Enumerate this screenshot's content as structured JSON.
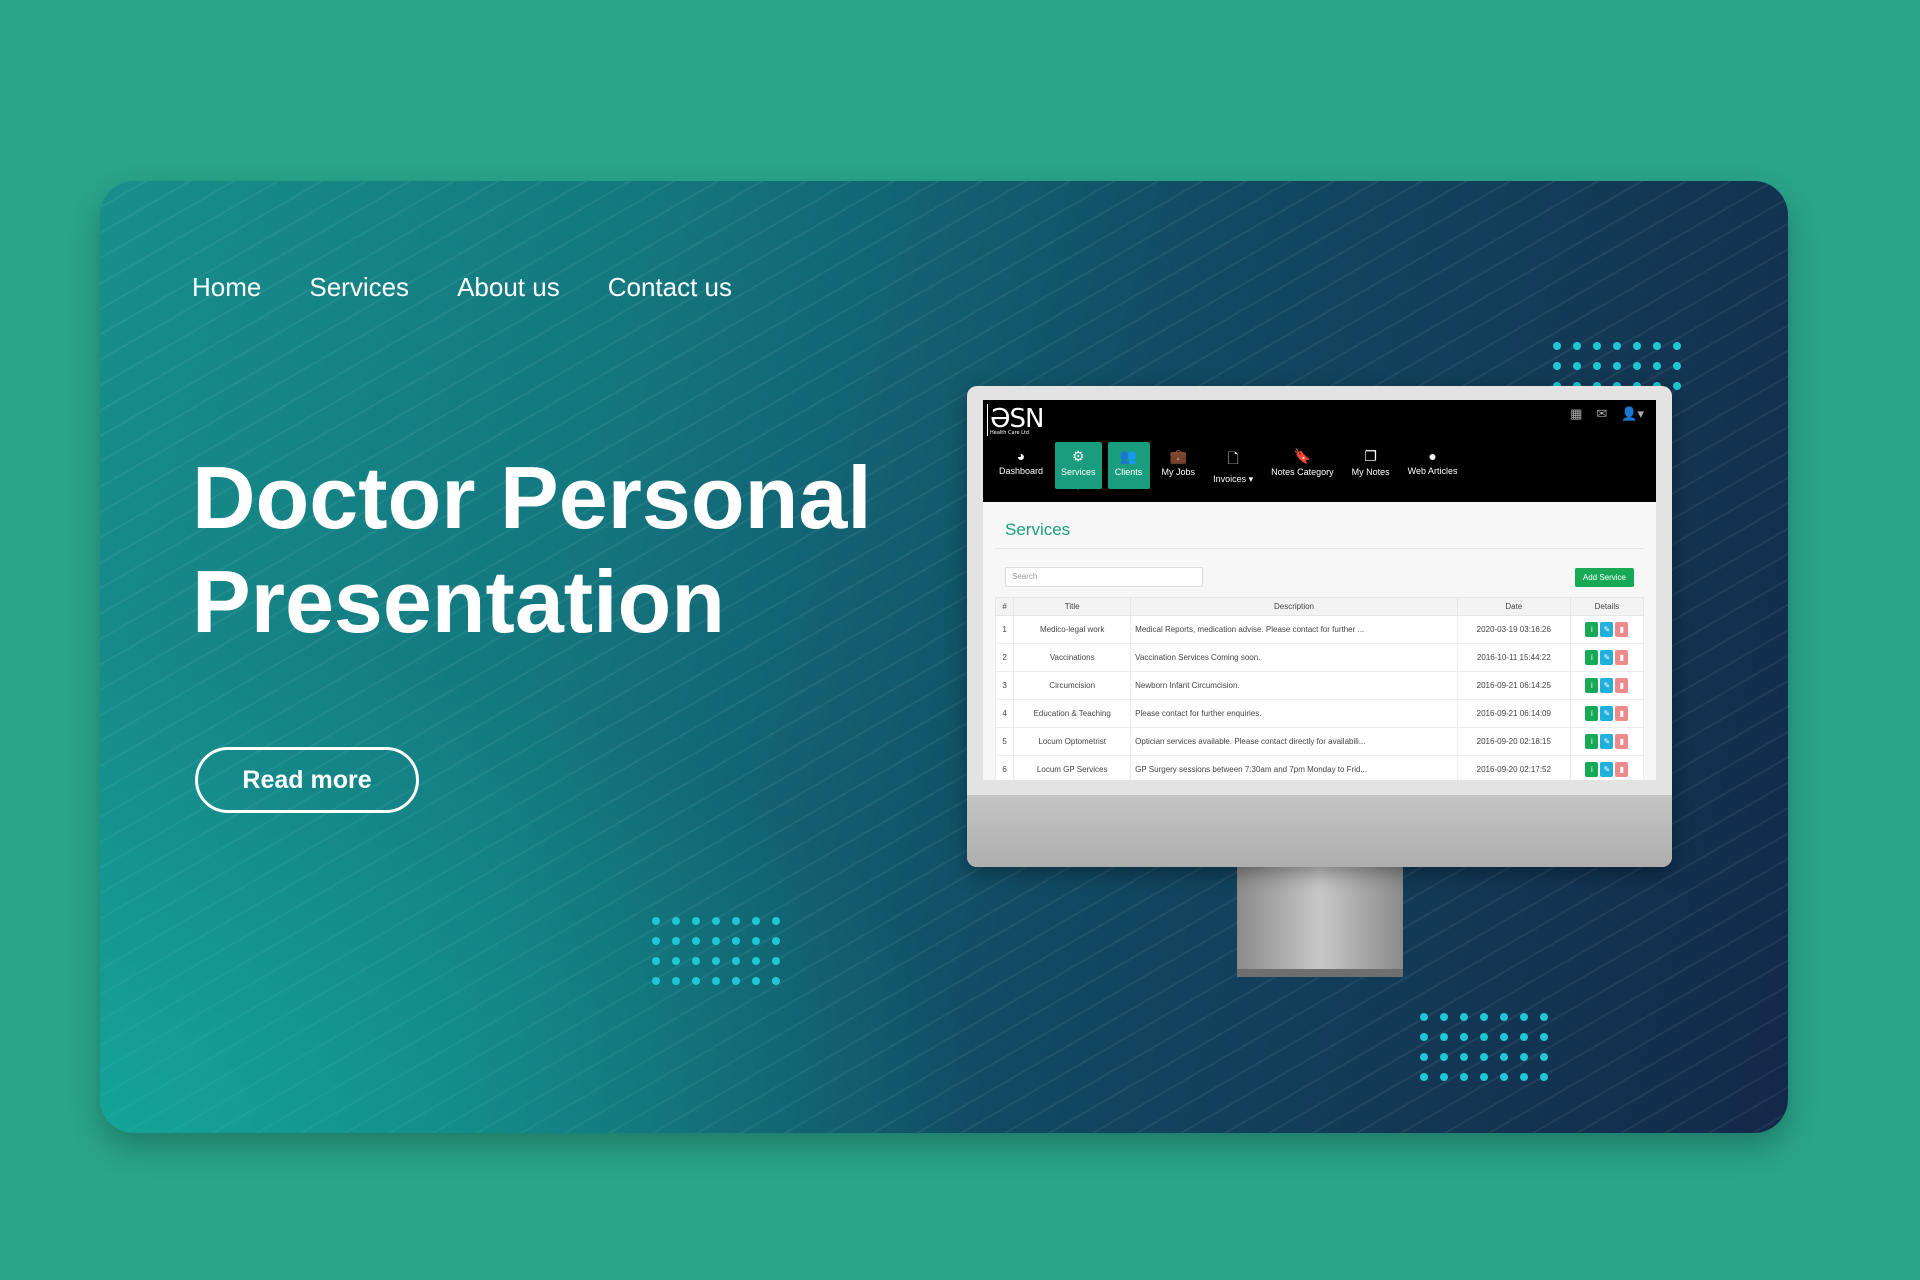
{
  "nav": [
    "Home",
    "Services",
    "About us",
    "Contact us"
  ],
  "hero": {
    "title_line1": "Doctor Personal",
    "title_line2": "Presentation",
    "button": "Read more"
  },
  "colors": {
    "background": "#29a58a",
    "accent": "#1a9c7e",
    "add_button": "#18a957"
  },
  "app": {
    "logo": "ƏSN",
    "logo_sub": "Health Care Ltd",
    "menu": [
      {
        "label": "Dashboard",
        "icon": "dashboard-icon"
      },
      {
        "label": "Services",
        "icon": "cogs-icon"
      },
      {
        "label": "Clients",
        "icon": "users-icon"
      },
      {
        "label": "My Jobs",
        "icon": "briefcase-icon"
      },
      {
        "label": "Invoices ▾",
        "icon": "file-icon"
      },
      {
        "label": "Notes Category",
        "icon": "bookmark-icon"
      },
      {
        "label": "My Notes",
        "icon": "copy-icon"
      },
      {
        "label": "Web Articles",
        "icon": "globe-icon"
      }
    ],
    "page_title": "Services",
    "search_placeholder": "Search",
    "add_button": "Add Service",
    "columns": [
      "#",
      "Title",
      "Description",
      "Date",
      "Details"
    ],
    "rows": [
      [
        "1",
        "Medico-legal work",
        "Medical Reports, medication advise. Please contact for further ...",
        "2020-03-19 03:16:26"
      ],
      [
        "2",
        "Vaccinations",
        "Vaccination Services Coming soon.",
        "2016-10-11 15:44:22"
      ],
      [
        "3",
        "Circumcision",
        "Newborn Infant Circumcision.",
        "2016-09-21 06:14:25"
      ],
      [
        "4",
        "Education & Teaching",
        "Please contact for further enquiries.",
        "2016-09-21 06:14:09"
      ],
      [
        "5",
        "Locum Optometrist",
        "Optician services available. Please contact directly for availabili...",
        "2016-09-20 02:18:15"
      ],
      [
        "6",
        "Locum GP Services",
        "GP Surgery sessions between 7:30am and 7pm Monday to Frid...",
        "2016-09-20 02:17:52"
      ]
    ]
  }
}
